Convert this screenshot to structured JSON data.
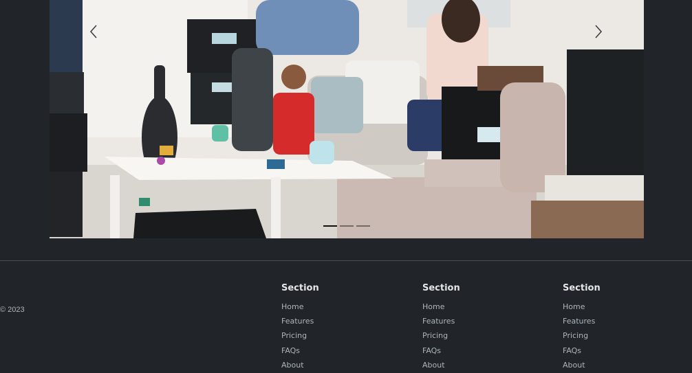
{
  "carousel": {
    "indicators": [
      {
        "active": true
      },
      {
        "active": false
      },
      {
        "active": false
      }
    ],
    "prev_icon": "chevron-left-icon",
    "next_icon": "chevron-right-icon"
  },
  "footer": {
    "copyright": "© 2023",
    "columns": [
      {
        "title": "Section",
        "links": [
          "Home",
          "Features",
          "Pricing",
          "FAQs",
          "About"
        ]
      },
      {
        "title": "Section",
        "links": [
          "Home",
          "Features",
          "Pricing",
          "FAQs",
          "About"
        ]
      },
      {
        "title": "Section",
        "links": [
          "Home",
          "Features",
          "Pricing",
          "FAQs",
          "About"
        ]
      }
    ]
  },
  "colors": {
    "background": "#212529",
    "footer_text": "#adb5bd",
    "heading_text": "#e4e6e8",
    "divider": "#4a4f55"
  }
}
